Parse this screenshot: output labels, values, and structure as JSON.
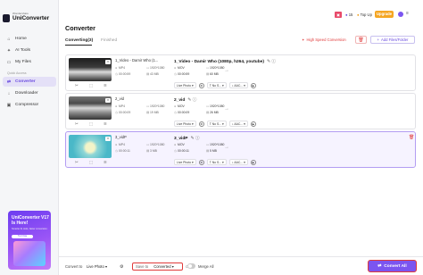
{
  "app": {
    "brand_small": "Wondershare",
    "brand_name": "UniConverter"
  },
  "topbar": {
    "upgrade_label": "Upgrade",
    "topup_label": "Top Up",
    "badge_count": "15"
  },
  "sidebar": {
    "items": [
      {
        "label": "Home",
        "icon": "home-icon"
      },
      {
        "label": "AI Tools",
        "icon": "ai-icon"
      },
      {
        "label": "My Files",
        "icon": "folder-icon"
      }
    ],
    "quick_access_label": "Quick Access",
    "quick_items": [
      {
        "label": "Converter",
        "icon": "converter-icon",
        "active": true
      },
      {
        "label": "Downloader",
        "icon": "download-icon"
      },
      {
        "label": "Compressor",
        "icon": "compress-icon"
      }
    ]
  },
  "promo": {
    "title": "UniConverter V17 Is Here!",
    "subtitle": "Smarter AI tools, faster conversion.",
    "button": "Try It Now"
  },
  "main": {
    "title": "Converter",
    "tabs": [
      {
        "label": "Converting(3)"
      },
      {
        "label": "Finished"
      }
    ],
    "high_speed_label": "High Speed Conversion",
    "add_files_label": "Add Files/Folder",
    "files": [
      {
        "source": {
          "name": "1_Video - Damir Who (1...",
          "format": "MP4",
          "resolution": "1920*1080",
          "duration": "00:00:59",
          "size": "43 MB"
        },
        "output": {
          "name": "1_Video - Damir Who (1080p, h264, youtube)",
          "format": "MOV",
          "resolution": "1920*1080",
          "duration": "00:00:59",
          "size": "60 MB",
          "preset": "Live Photo",
          "subtitle": "No S...",
          "audio": "AAC..."
        }
      },
      {
        "source": {
          "name": "2_vid",
          "format": "MP4",
          "resolution": "1920*1080",
          "duration": "00:00:09",
          "size": "19 MB"
        },
        "output": {
          "name": "2_vid",
          "format": "MOV",
          "resolution": "1920*1080",
          "duration": "00:00:09",
          "size": "26 MB",
          "preset": "Live Photo",
          "subtitle": "No S...",
          "audio": "AAC..."
        }
      },
      {
        "source": {
          "name": "3_vidP",
          "format": "MP4",
          "resolution": "1920*1080",
          "duration": "00:00:11",
          "size": "3 MB"
        },
        "output": {
          "name": "3_vidP",
          "format": "MOV",
          "resolution": "1920*1080",
          "duration": "00:00:11",
          "size": "5 MB",
          "preset": "Live Photo",
          "subtitle": "No S...",
          "audio": "AAC..."
        }
      }
    ]
  },
  "bottom": {
    "convert_to_label": "Convert to",
    "convert_to_value": "Live Photo",
    "save_to_label": "Save to",
    "save_to_value": "Converted",
    "merge_label": "Merge All",
    "convert_all_label": "Convert All"
  },
  "colors": {
    "accent": "#7b55f0",
    "highlight": "#e03a3a"
  }
}
